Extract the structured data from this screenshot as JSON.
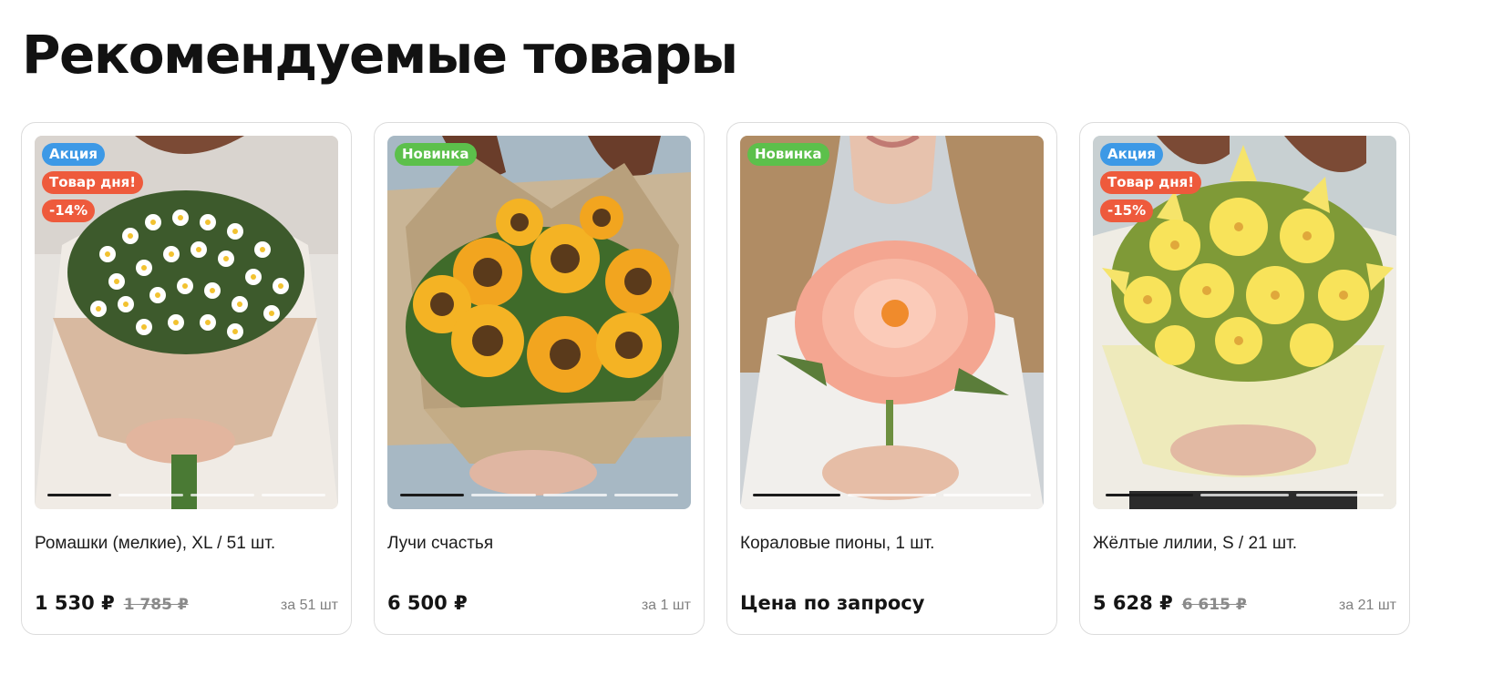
{
  "section": {
    "title": "Рекомендуемые товары"
  },
  "colors": {
    "promo": "#3d99e6",
    "new": "#5cc04b",
    "hot": "#ee5a3c"
  },
  "products": [
    {
      "name": "Ромашки (мелкие), XL / 51 шт.",
      "price": "1 530 ₽",
      "old_price": "1 785 ₽",
      "per": "за 51 шт",
      "badges": [
        {
          "label": "Акция",
          "kind": "promo"
        },
        {
          "label": "Товар дня!",
          "kind": "hot"
        },
        {
          "label": "-14%",
          "kind": "hot"
        }
      ],
      "image": "daisy-bouquet",
      "slides": 4,
      "active_slide": 1
    },
    {
      "name": "Лучи счастья",
      "price": "6 500 ₽",
      "old_price": "",
      "per": "за 1 шт",
      "badges": [
        {
          "label": "Новинка",
          "kind": "new"
        }
      ],
      "image": "sunflower-bouquet",
      "slides": 4,
      "active_slide": 1
    },
    {
      "name": "Кораловые пионы, 1 шт.",
      "price": "Цена по запросу",
      "old_price": "",
      "per": "",
      "badges": [
        {
          "label": "Новинка",
          "kind": "new"
        }
      ],
      "image": "coral-peony",
      "slides": 3,
      "active_slide": 1
    },
    {
      "name": "Жёлтые лилии, S / 21 шт.",
      "price": "5 628 ₽",
      "old_price": "6 615 ₽",
      "per": "за 21 шт",
      "badges": [
        {
          "label": "Акция",
          "kind": "promo"
        },
        {
          "label": "Товар дня!",
          "kind": "hot"
        },
        {
          "label": "-15%",
          "kind": "hot"
        }
      ],
      "image": "yellow-lily-bouquet",
      "slides": 3,
      "active_slide": 1
    }
  ]
}
